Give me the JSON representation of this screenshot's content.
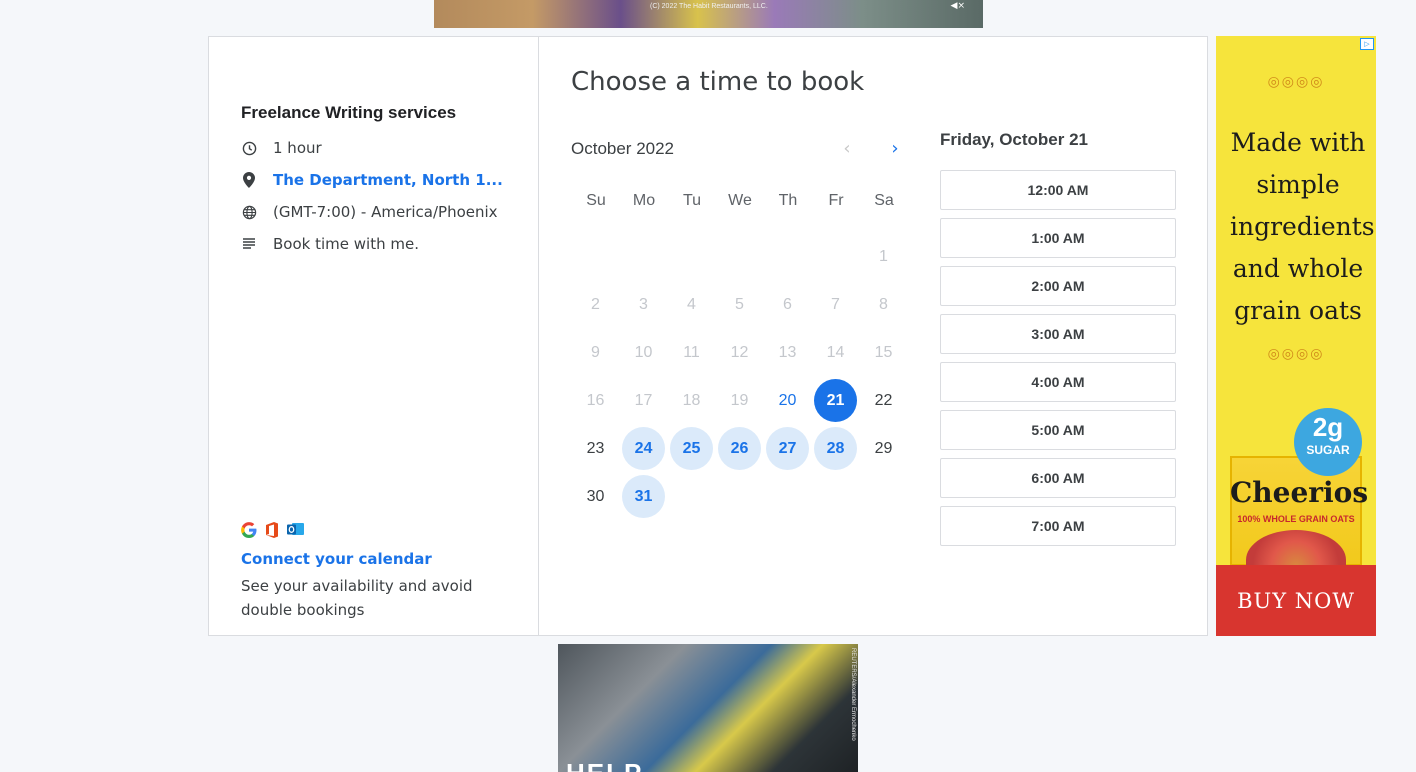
{
  "top_ad": {
    "copyright": "(C) 2022 The Habit Restaurants, LLC."
  },
  "booking": {
    "service": {
      "title": "Freelance Writing services",
      "duration": "1 hour",
      "location": "The Department, North 1...",
      "timezone": "(GMT-7:00) - America/Phoenix",
      "description": "Book time with me."
    },
    "connect": {
      "link": "Connect your calendar",
      "text": "See your availability and avoid double bookings"
    },
    "heading": "Choose a time to book",
    "calendar": {
      "month": "October 2022",
      "weekdays": [
        "Su",
        "Mo",
        "Tu",
        "We",
        "Th",
        "Fr",
        "Sa"
      ],
      "days": [
        {
          "d": "1",
          "state": "disabled"
        },
        {
          "d": "2",
          "state": "disabled"
        },
        {
          "d": "3",
          "state": "disabled"
        },
        {
          "d": "4",
          "state": "disabled"
        },
        {
          "d": "5",
          "state": "disabled"
        },
        {
          "d": "6",
          "state": "disabled"
        },
        {
          "d": "7",
          "state": "disabled"
        },
        {
          "d": "8",
          "state": "disabled"
        },
        {
          "d": "9",
          "state": "disabled"
        },
        {
          "d": "10",
          "state": "disabled"
        },
        {
          "d": "11",
          "state": "disabled"
        },
        {
          "d": "12",
          "state": "disabled"
        },
        {
          "d": "13",
          "state": "disabled"
        },
        {
          "d": "14",
          "state": "disabled"
        },
        {
          "d": "15",
          "state": "disabled"
        },
        {
          "d": "16",
          "state": "disabled"
        },
        {
          "d": "17",
          "state": "disabled"
        },
        {
          "d": "18",
          "state": "disabled"
        },
        {
          "d": "19",
          "state": "disabled"
        },
        {
          "d": "20",
          "state": "available"
        },
        {
          "d": "21",
          "state": "selected"
        },
        {
          "d": "22",
          "state": "normal"
        },
        {
          "d": "23",
          "state": "normal"
        },
        {
          "d": "24",
          "state": "available-bg"
        },
        {
          "d": "25",
          "state": "available-bg"
        },
        {
          "d": "26",
          "state": "available-bg"
        },
        {
          "d": "27",
          "state": "available-bg"
        },
        {
          "d": "28",
          "state": "available-bg"
        },
        {
          "d": "29",
          "state": "normal"
        },
        {
          "d": "30",
          "state": "normal"
        },
        {
          "d": "31",
          "state": "available-bg"
        }
      ]
    },
    "selected_day": "Friday, October 21",
    "slots": [
      "12:00 AM",
      "1:00 AM",
      "2:00 AM",
      "3:00 AM",
      "4:00 AM",
      "5:00 AM",
      "6:00 AM",
      "7:00 AM"
    ],
    "colors": {
      "accent": "#1a73e8",
      "available_bg": "#dbeafa",
      "disabled": "#c4c7cc"
    }
  },
  "right_ad": {
    "tagline": "Made with simple ingredients and whole grain oats",
    "sugar_big": "2g",
    "sugar_small": "SUGAR",
    "brand": "Cheerios",
    "oats": "100% WHOLE GRAIN OATS",
    "cta": "BUY NOW"
  },
  "bottom_ad": {
    "headline": "HELP",
    "credit": "REUTERS/Alexander Ermochenko"
  }
}
